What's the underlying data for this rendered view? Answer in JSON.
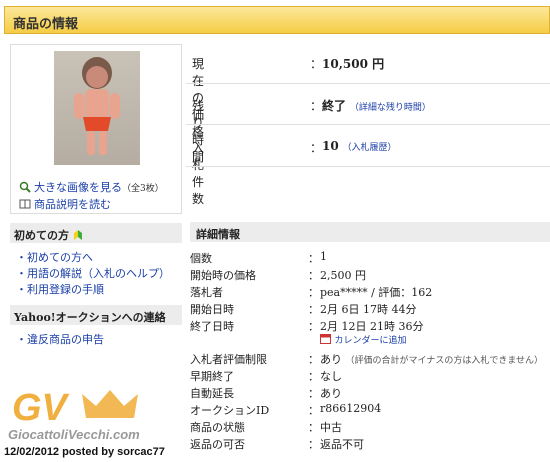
{
  "header": {
    "title": "商品の情報"
  },
  "image_panel": {
    "view_large_label": "大きな画像を見る",
    "view_large_count": "（全3枚）",
    "description_label": "商品説明を読む"
  },
  "price": {
    "label": "現在の価格",
    "colon": "：",
    "value": "10,500 円"
  },
  "time_left": {
    "label": "残り時間",
    "colon": "：",
    "value": "終了",
    "link": "（詳細な残り時間）"
  },
  "bids": {
    "label": "入札件数",
    "colon": "：",
    "value": "10",
    "link": "（入札履歴）"
  },
  "beginner": {
    "title": "初めての方",
    "items": [
      "・初めての方へ",
      "・用語の解説（入札のヘルプ）",
      "・利用登録の手順"
    ]
  },
  "contact": {
    "title": "Yahoo!オークションへの連絡",
    "items": [
      "・違反商品の申告"
    ]
  },
  "details": {
    "title": "詳細情報",
    "rows": [
      {
        "label": "個数",
        "colon": "：",
        "value": "1"
      },
      {
        "label": "開始時の価格",
        "colon": "：",
        "value": "2,500 円"
      },
      {
        "label": "落札者",
        "colon": "：",
        "value": "pea***** / 評価：162"
      },
      {
        "label": "開始日時",
        "colon": "：",
        "value": "2月 6日 17時 44分"
      },
      {
        "label": "終了日時",
        "colon": "：",
        "value": "2月 12日 21時 36分"
      },
      {
        "label": "入札者評価制限",
        "colon": "：",
        "value": "あり",
        "note": "（評価の合計がマイナスの方は入札できません）"
      },
      {
        "label": "早期終了",
        "colon": "：",
        "value": "なし"
      },
      {
        "label": "自動延長",
        "colon": "：",
        "value": "あり"
      },
      {
        "label": "オークションID",
        "colon": "：",
        "value": "r86612904"
      },
      {
        "label": "商品の状態",
        "colon": "：",
        "value": "中古"
      },
      {
        "label": "返品の可否",
        "colon": "：",
        "value": "返品不可"
      }
    ],
    "calendar_link": "カレンダーに追加"
  },
  "watermark": {
    "logo": "GV",
    "site": "GiocattoliVecchi.com",
    "posted": "12/02/2012 posted by sorcac77"
  },
  "colors": {
    "header": "#f5cc45",
    "link": "#1a3fa8",
    "panel": "#ececec",
    "watermark": "#f0b040"
  }
}
